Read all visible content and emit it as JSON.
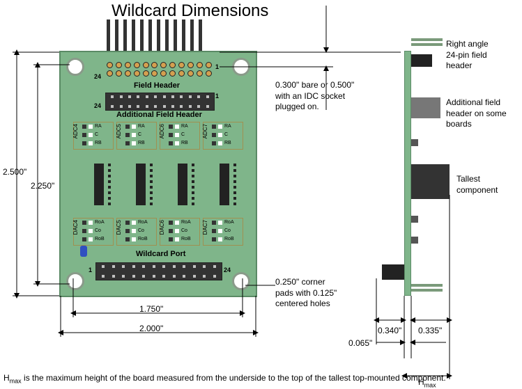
{
  "title": "Wildcard Dimensions",
  "board_labels": {
    "field_header": "Field Header",
    "addl_field_header": "Additional Field Header",
    "wildcard_port": "Wildcard Port",
    "pin1": "1",
    "pin24": "24"
  },
  "adc_dac": {
    "adc": [
      "ADC4",
      "ADC5",
      "ADC6",
      "ADC7"
    ],
    "dac": [
      "DAC4",
      "DAC5",
      "DAC6",
      "DAC7"
    ],
    "adc_rows": [
      "RA",
      "C",
      "RB"
    ],
    "dac_rows": [
      "RoA",
      "Co",
      "RoB"
    ]
  },
  "dimensions": {
    "height_outer": "2.500\"",
    "height_inner": "2.250\"",
    "width_outer": "2.000\"",
    "width_inner": "1.750\"",
    "side_front": "0.340\"",
    "side_back": "0.335\"",
    "side_board": "0.065\"",
    "hmax": "Hmax"
  },
  "callouts": {
    "right_angle": "Right angle\n24-pin field\nheader",
    "bare_socket": "0.300\" bare or 0.500\"\nwith an IDC socket\nplugged on.",
    "addl_field": "Additional field\nheader on some\nboards",
    "tallest": "Tallest\ncomponent",
    "corner_pads": "0.250\" corner\npads with 0.125\"\ncentered holes"
  },
  "footnote": "Hmax is the maximum height of the board measured from the\nunderside to the top of the tallest top-mounted component."
}
